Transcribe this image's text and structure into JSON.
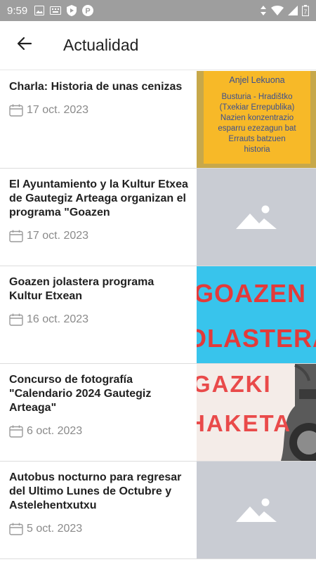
{
  "status_bar": {
    "time": "9:59",
    "battery": "7"
  },
  "header": {
    "title": "Actualidad"
  },
  "items": [
    {
      "title": "Charla: Historia de unas cenizas",
      "date": "17 oct. 2023",
      "thumb": {
        "type": "poster",
        "heading": "Anjel Lekuona",
        "lines": [
          "Busturia - Hradištko",
          "(Txekiar Errepublika)",
          "Nazien konzentrazio",
          "esparru ezezagun bat",
          "Errauts batzuen",
          "historia"
        ]
      }
    },
    {
      "title": "El Ayuntamiento y la Kultur Etxea de Gautegiz Arteaga organizan el programa \"Goazen",
      "date": "17 oct. 2023",
      "thumb": {
        "type": "placeholder"
      }
    },
    {
      "title": "Goazen jolastera programa Kultur Etxean",
      "date": "16 oct. 2023",
      "thumb": {
        "type": "banner",
        "lines": [
          "GOAZEN",
          "OLASTERA"
        ]
      }
    },
    {
      "title": "Concurso de fotografía \"Calendario 2024 Gautegiz Arteaga\"",
      "date": "6 oct. 2023",
      "thumb": {
        "type": "photo",
        "lines": [
          "GAZKI",
          "HAKETA"
        ]
      }
    },
    {
      "title": "Autobus nocturno para regresar del Ultimo Lunes de Octubre y Astelehentxutxu",
      "date": "5 oct. 2023",
      "thumb": {
        "type": "placeholder"
      }
    }
  ],
  "colors": {
    "status_bar": "#9e9e9e",
    "placeholder": "#c9ccd3",
    "date_text": "#8a8a8a"
  }
}
